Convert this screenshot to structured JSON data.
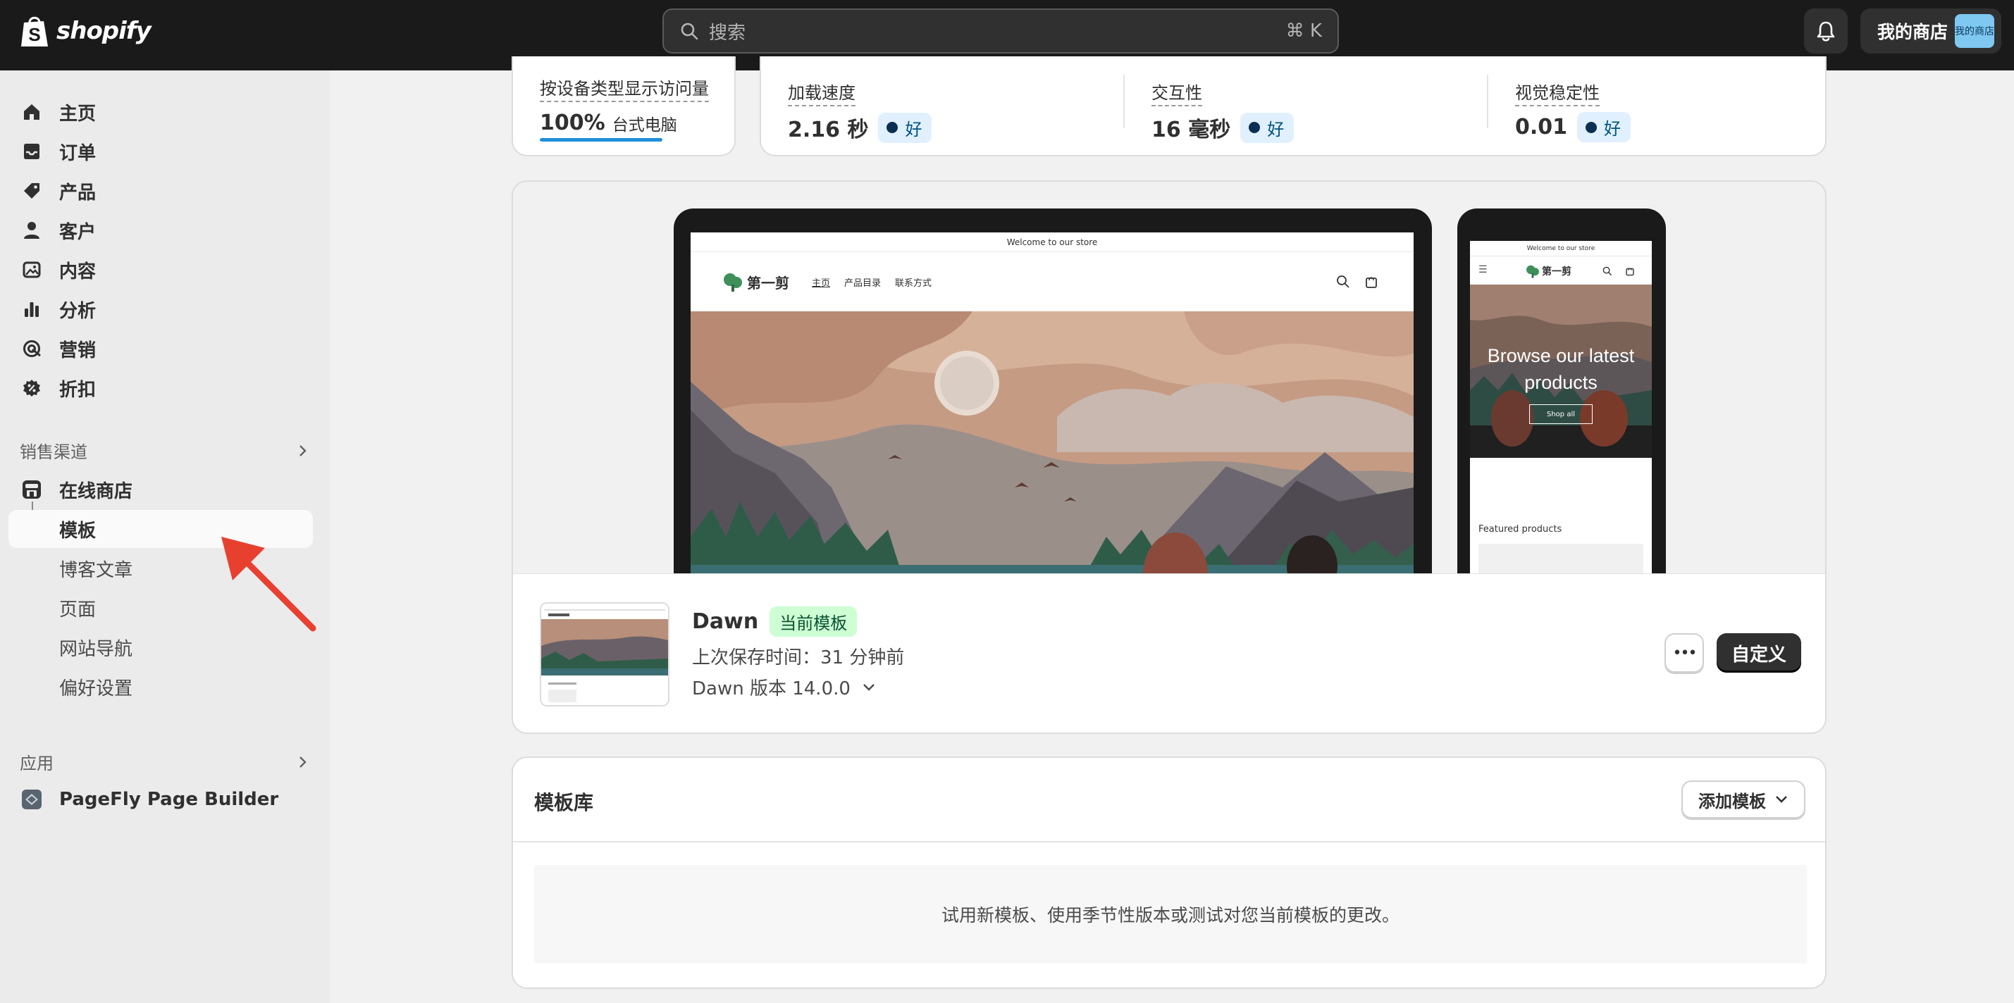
{
  "topbar": {
    "logo_text": "shopify",
    "search_placeholder": "搜索",
    "search_shortcut": "⌘ K",
    "store_name": "我的商店",
    "avatar_text": "我的商店"
  },
  "sidebar": {
    "main_items": [
      {
        "label": "主页",
        "icon": "home-icon"
      },
      {
        "label": "订单",
        "icon": "inbox-icon"
      },
      {
        "label": "产品",
        "icon": "tag-icon"
      },
      {
        "label": "客户",
        "icon": "person-icon"
      },
      {
        "label": "内容",
        "icon": "image-icon"
      },
      {
        "label": "分析",
        "icon": "bar-chart-icon"
      },
      {
        "label": "营销",
        "icon": "target-icon"
      },
      {
        "label": "折扣",
        "icon": "discount-icon"
      }
    ],
    "sales_channels_label": "销售渠道",
    "online_store_label": "在线商店",
    "online_store_sub": [
      "模板",
      "博客文章",
      "页面",
      "网站导航",
      "偏好设置"
    ],
    "apps_label": "应用",
    "app_name": "PageFly Page Builder"
  },
  "metrics": {
    "device": {
      "label": "按设备类型显示访问量",
      "value": "100%",
      "unit": "台式电脑",
      "fraction": 1.0
    },
    "items": [
      {
        "label": "加载速度",
        "value": "2.16 秒",
        "badge": "好"
      },
      {
        "label": "交互性",
        "value": "16 毫秒",
        "badge": "好"
      },
      {
        "label": "视觉稳定性",
        "value": "0.01",
        "badge": "好"
      }
    ]
  },
  "preview": {
    "desktop": {
      "announcement": "Welcome to our store",
      "brand": "第一剪",
      "nav": [
        "主页",
        "产品目录",
        "联系方式"
      ]
    },
    "mobile": {
      "announcement": "Welcome to our store",
      "brand": "第一剪",
      "hero_title": "Browse our latest products",
      "hero_button": "Shop all",
      "featured": "Featured products"
    }
  },
  "theme": {
    "name": "Dawn",
    "status": "当前模板",
    "saved": "上次保存时间：31 分钟前",
    "version": "Dawn 版本 14.0.0",
    "more": "•••",
    "customize": "自定义"
  },
  "library": {
    "title": "模板库",
    "add_button": "添加模板",
    "empty_text": "试用新模板、使用季节性版本或测试对您当前模板的更改。"
  },
  "colors": {
    "topbar": "#1a1a1a",
    "sidebar": "#ebebeb",
    "accent_blue": "#1f8fd9",
    "good_badge": "#e0f0ff",
    "current_badge": "#cdfed4",
    "annotation_arrow": "#e8402f"
  }
}
